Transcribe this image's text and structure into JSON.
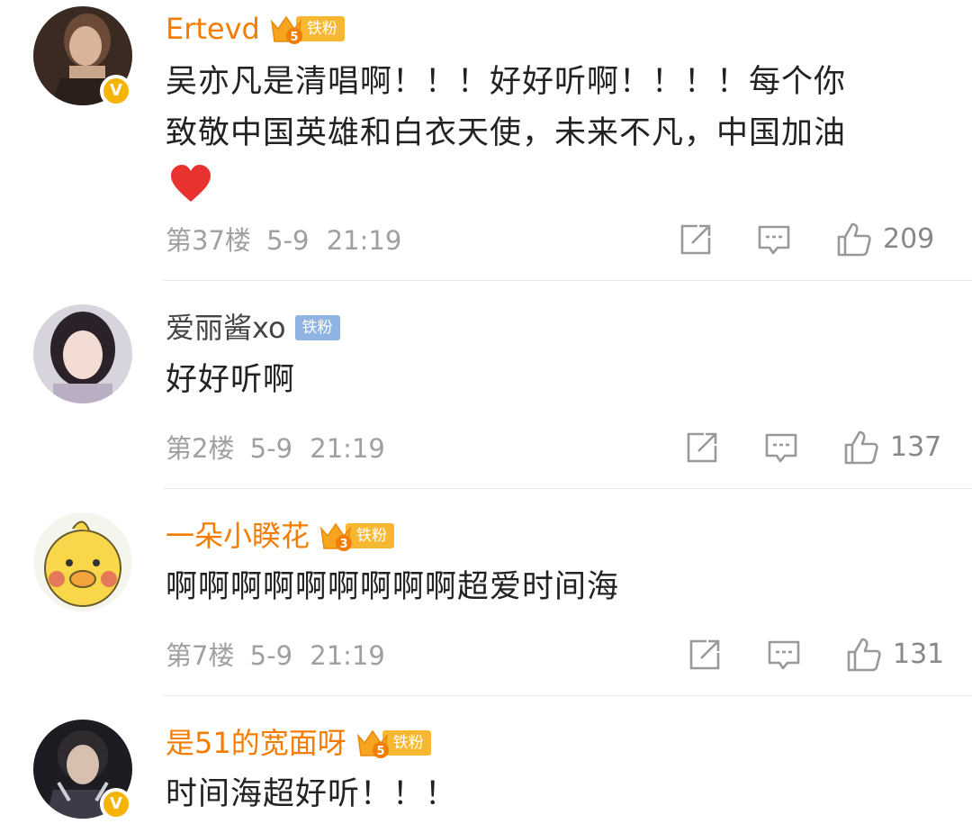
{
  "comments": [
    {
      "username": "Ertevd",
      "fan_badge": "铁粉",
      "fan_level": "5",
      "verified": "V",
      "lines": [
        "吴亦凡是清唱啊！！！好好听啊！！！！每个你",
        "致敬中国英雄和白衣天使，未来不凡，中国加油"
      ],
      "floor": "第37楼",
      "date": "5-9",
      "time": "21:19",
      "likes": "209"
    },
    {
      "username": "爱丽酱xo",
      "fan_badge": "铁粉",
      "lines": [
        "好好听啊"
      ],
      "floor": "第2楼",
      "date": "5-9",
      "time": "21:19",
      "likes": "137"
    },
    {
      "username": "一朵小睽花",
      "fan_badge": "铁粉",
      "fan_level": "3",
      "lines": [
        "啊啊啊啊啊啊啊啊啊超爱时间海"
      ],
      "floor": "第7楼",
      "date": "5-9",
      "time": "21:19",
      "likes": "131"
    },
    {
      "username": "是51的宽面呀",
      "fan_badge": "铁粉",
      "fan_level": "5",
      "verified": "V",
      "lines": [
        "时间海超好听！！！"
      ]
    }
  ],
  "icons": {
    "share": "share-icon",
    "reply": "comment-icon",
    "like": "thumbs-up-icon",
    "heart": "heart-emoji-icon",
    "crown": "crown-icon"
  },
  "colors": {
    "username_highlight": "#f47c00",
    "fan_badge_gold": "#f7b731",
    "fan_badge_blue": "#8fb4e3",
    "verified_badge": "#f4b400",
    "meta_gray": "#a0a0a0",
    "heart_red": "#e8322f"
  }
}
